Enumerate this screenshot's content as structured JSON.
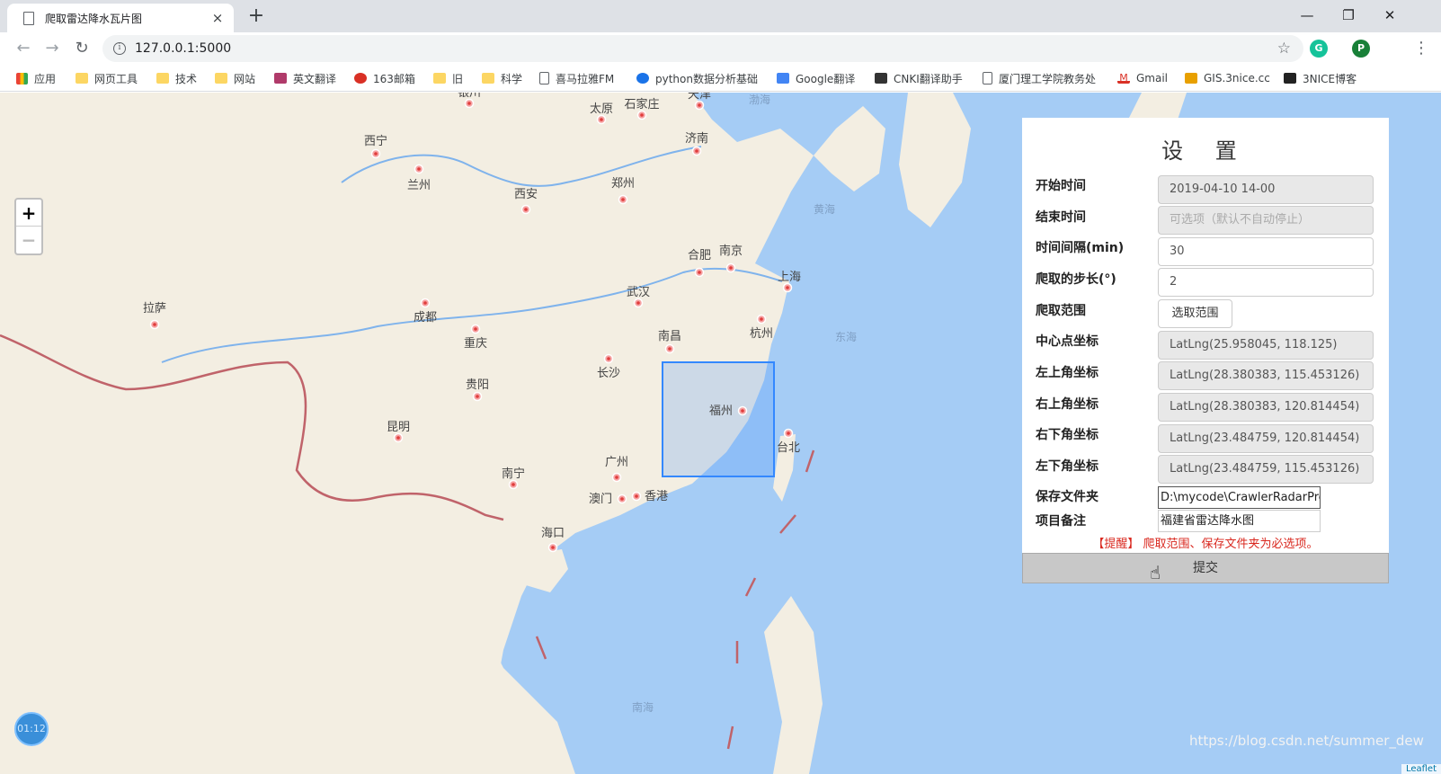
{
  "browser": {
    "tab_title": "爬取雷达降水瓦片图",
    "tab_close": "×",
    "new_tab": "+",
    "url": "127.0.0.1:5000",
    "window_controls": {
      "minimize": "—",
      "maximize": "❐",
      "close": "✕"
    },
    "nav": {
      "back": "←",
      "forward": "→",
      "reload": "↻"
    },
    "ext_grammarly": "G",
    "profile": "P"
  },
  "bookmarks": [
    {
      "label": "应用",
      "icon": "apps-icon"
    },
    {
      "label": "网页工具",
      "icon": "folder-icon"
    },
    {
      "label": "技术",
      "icon": "folder-icon"
    },
    {
      "label": "网站",
      "icon": "folder-icon"
    },
    {
      "label": "英文翻译",
      "icon": "bookmark-icon"
    },
    {
      "label": "163邮箱",
      "icon": "bookmark-icon"
    },
    {
      "label": "旧",
      "icon": "folder-icon"
    },
    {
      "label": "科学",
      "icon": "folder-icon"
    },
    {
      "label": "喜马拉雅FM",
      "icon": "page-icon"
    },
    {
      "label": "python数据分析基础",
      "icon": "bookmark-icon"
    },
    {
      "label": "Google翻译",
      "icon": "bookmark-icon"
    },
    {
      "label": "CNKI翻译助手",
      "icon": "bookmark-icon"
    },
    {
      "label": "厦门理工学院教务处",
      "icon": "page-icon"
    },
    {
      "label": "Gmail",
      "icon": "gmail-icon"
    },
    {
      "label": "GIS.3nice.cc",
      "icon": "bookmark-icon"
    },
    {
      "label": "3NICE博客",
      "icon": "bookmark-icon"
    }
  ],
  "map": {
    "zoom_in": "+",
    "zoom_out": "−",
    "cities": [
      "银川",
      "太原",
      "石家庄",
      "天津",
      "西宁",
      "兰州",
      "济南",
      "西安",
      "郑州",
      "合肥",
      "南京",
      "上海",
      "武汉",
      "杭州",
      "拉萨",
      "成都",
      "重庆",
      "南昌",
      "长沙",
      "贵阳",
      "福州",
      "昆明",
      "台北",
      "广州",
      "南宁",
      "澳门",
      "香港",
      "海口"
    ],
    "seas": [
      "渤海",
      "黄海",
      "东海",
      "南海"
    ],
    "timer": "01:12",
    "watermark": "https://blog.csdn.net/summer_dew",
    "attribution": "Leaflet"
  },
  "settings": {
    "title": "设 置",
    "fields": [
      {
        "label": "开始时间",
        "value": "2019-04-10 14-00"
      },
      {
        "label": "结束时间",
        "value": "可选项（默认不自动停止）"
      },
      {
        "label": "时间间隔(min)",
        "value": "30"
      },
      {
        "label": "爬取的步长(°)",
        "value": "2"
      },
      {
        "label": "爬取范围",
        "value": "选取范围"
      },
      {
        "label": "中心点坐标",
        "value": "LatLng(25.958045, 118.125)"
      },
      {
        "label": "左上角坐标",
        "value": "LatLng(28.380383, 115.453126)"
      },
      {
        "label": "右上角坐标",
        "value": "LatLng(28.380383, 120.814454)"
      },
      {
        "label": "右下角坐标",
        "value": "LatLng(23.484759, 120.814454)"
      },
      {
        "label": "左下角坐标",
        "value": "LatLng(23.484759, 115.453126)"
      },
      {
        "label": "保存文件夹",
        "value": "D:\\mycode\\CrawlerRadarPre"
      },
      {
        "label": "项目备注",
        "value": "福建省雷达降水图"
      }
    ],
    "warning": "【提醒】 爬取范围、保存文件夹为必选项。",
    "submit": "提交"
  }
}
